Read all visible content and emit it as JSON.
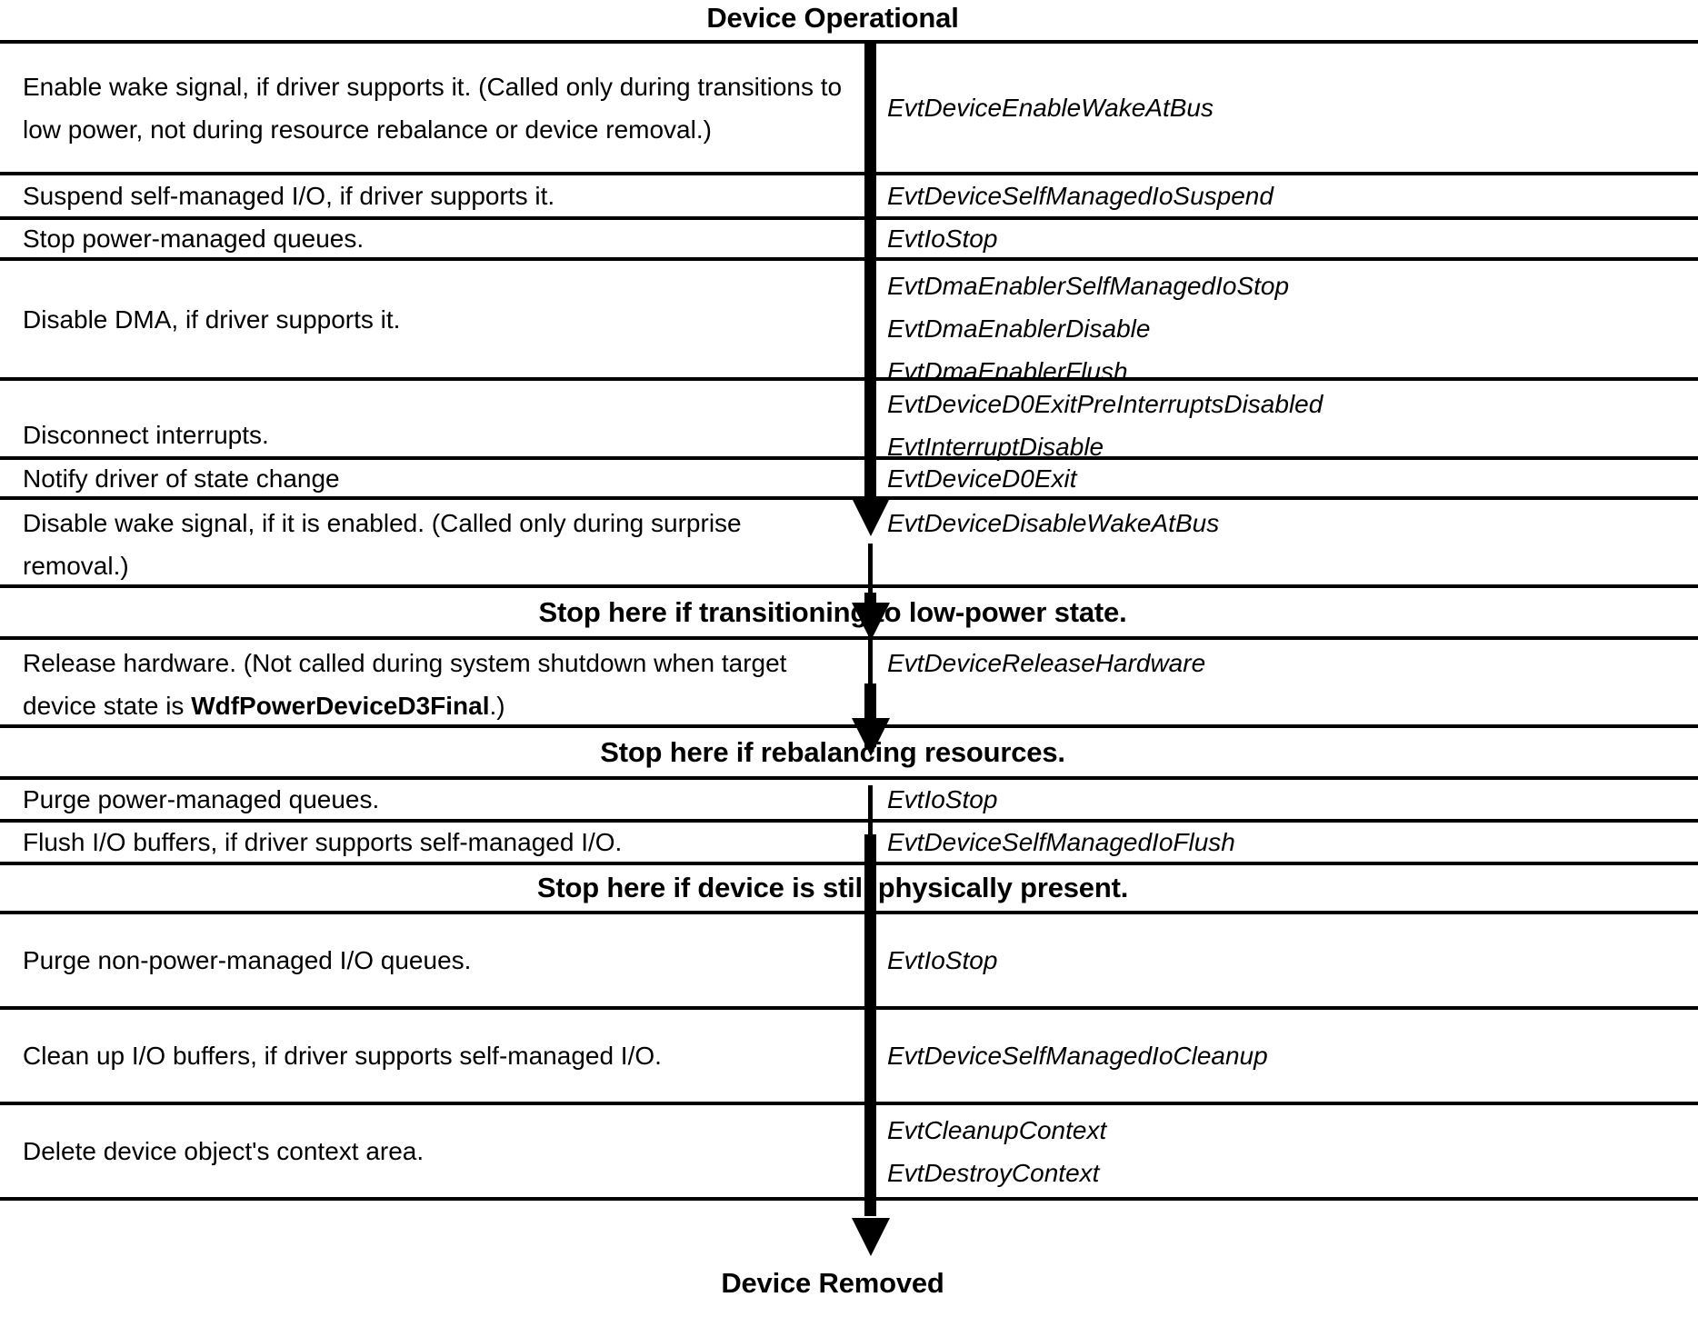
{
  "diagram": {
    "title_top": "Device Operational",
    "title_bottom": "Device Removed",
    "accent_color": "#000000",
    "background_color": "#ffffff"
  },
  "rows": [
    {
      "id": "enable-wake-signal",
      "left": "Enable wake signal, if driver supports it. (Called only during transitions to low power, not during resource rebalance or device removal.)",
      "callbacks": [
        "EvtDeviceEnableWakeAtBus"
      ]
    },
    {
      "id": "suspend-self-managed-io",
      "left": "Suspend self-managed I/O, if driver supports it.",
      "callbacks": [
        "EvtDeviceSelfManagedIoSuspend"
      ]
    },
    {
      "id": "stop-power-managed-queues",
      "left": "Stop power-managed queues.",
      "callbacks": [
        "EvtIoStop"
      ]
    },
    {
      "id": "disable-dma",
      "left": "Disable DMA, if driver supports it.",
      "callbacks": [
        "EvtDmaEnablerSelfManagedIoStop",
        "EvtDmaEnablerDisable",
        "EvtDmaEnablerFlush"
      ]
    },
    {
      "id": "disconnect-interrupts",
      "left": "Disconnect interrupts.",
      "callbacks": [
        "EvtDeviceD0ExitPreInterruptsDisabled",
        "EvtInterruptDisable"
      ]
    },
    {
      "id": "notify-driver-state-change",
      "left": "Notify driver of state change",
      "callbacks": [
        "EvtDeviceD0Exit"
      ]
    },
    {
      "id": "disable-wake-signal",
      "left": "Disable wake signal, if it is enabled. (Called only during surprise removal.)",
      "callbacks": [
        "EvtDeviceDisableWakeAtBus"
      ]
    }
  ],
  "banner_low_power": "Stop here if transitioning to low-power state.",
  "rows_after_low_power": [
    {
      "id": "release-hardware",
      "left_prefix": "Release hardware. (Not called during system shutdown when target device state is ",
      "left_bold": "WdfPowerDeviceD3Final",
      "left_suffix": ".)",
      "callbacks": [
        "EvtDeviceReleaseHardware"
      ]
    }
  ],
  "banner_rebalance": "Stop here if rebalancing resources.",
  "rows_after_rebalance": [
    {
      "id": "purge-power-managed-queues",
      "left": "Purge power-managed queues.",
      "callbacks": [
        "EvtIoStop"
      ]
    },
    {
      "id": "flush-io-buffers",
      "left": "Flush I/O buffers, if driver supports self-managed I/O.",
      "callbacks": [
        "EvtDeviceSelfManagedIoFlush"
      ]
    }
  ],
  "banner_physically_present": "Stop here if device is still physically present.",
  "rows_after_present": [
    {
      "id": "purge-non-power-managed-queues",
      "left": "Purge non-power-managed I/O queues.",
      "callbacks": [
        "EvtIoStop"
      ]
    },
    {
      "id": "cleanup-io-buffers",
      "left": "Clean up I/O buffers, if driver supports self-managed I/O.",
      "callbacks": [
        "EvtDeviceSelfManagedIoCleanup"
      ]
    },
    {
      "id": "delete-context-area",
      "left": "Delete device object's context area.",
      "callbacks": [
        "EvtCleanupContext",
        "EvtDestroyContext"
      ]
    }
  ]
}
